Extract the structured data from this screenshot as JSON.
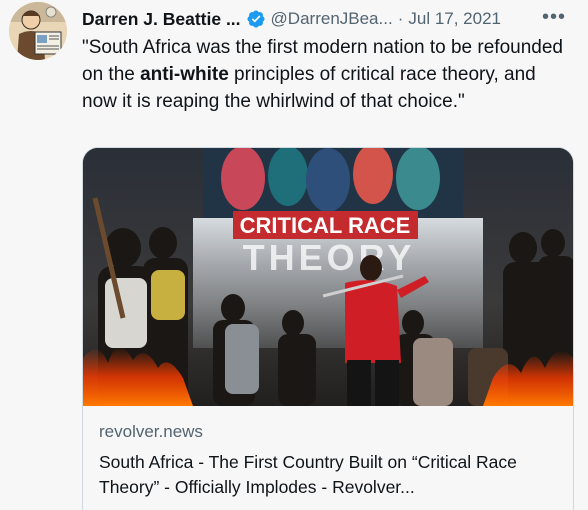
{
  "author": {
    "name": "Darren J. Beattie ...",
    "handle": "@DarrenJBea...",
    "separator": "·",
    "date": "Jul 17, 2021",
    "verified_icon": "verified-badge-icon",
    "more_icon": "more-icon"
  },
  "tweet": {
    "text_before": "\"South Africa was the first modern nation to be refounded on the ",
    "text_bold": "anti-white",
    "text_after": " principles of critical race theory, and now it is reaping the whirlwind of that choice.\""
  },
  "card": {
    "image_caption_line1": "CRITICAL RACE",
    "image_caption_line2": "THEORY",
    "domain": "revolver.news",
    "title": "South Africa - The First Country Built on “Critical Race Theory” - Officially Implodes - Revolver..."
  },
  "colors": {
    "accent": "#1d9bf0",
    "secondary_text": "#536471",
    "banner_red": "#c42b2e"
  }
}
